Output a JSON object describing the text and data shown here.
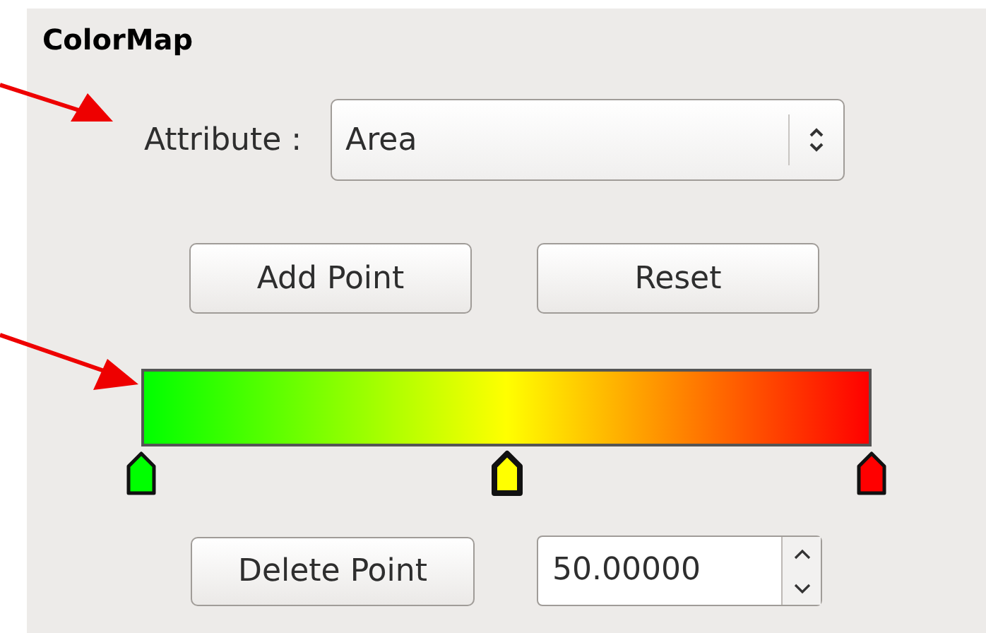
{
  "panel": {
    "title": "ColorMap"
  },
  "attribute": {
    "label": "Attribute :",
    "value": "Area"
  },
  "buttons": [
    "Add Point",
    "Reset"
  ],
  "gradient_points": [
    {
      "level": 0,
      "color": "#00ff00",
      "selected": false
    },
    {
      "level": 0.5,
      "color": "#ffff00",
      "selected": true
    },
    {
      "level": 1,
      "color": "#ff0000",
      "selected": false
    }
  ],
  "delete_button": "Delete Point",
  "position_field": {
    "value": "50.00000"
  }
}
